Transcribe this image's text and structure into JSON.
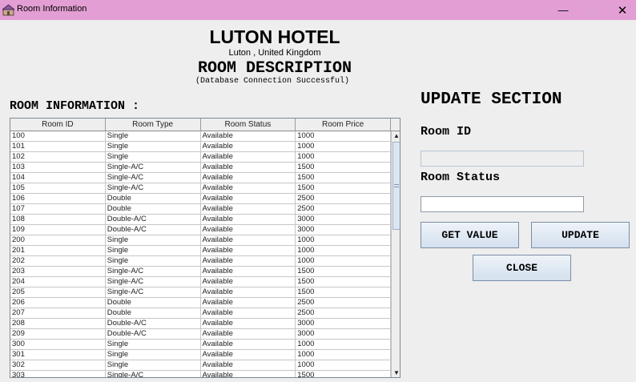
{
  "window": {
    "title": "Room Information",
    "min_glyph": "—",
    "max_glyph": "☐",
    "close_glyph": "✕"
  },
  "header": {
    "hotel_name": "LUTON HOTEL",
    "location": "Luton , United Kingdom",
    "section_title": "ROOM DESCRIPTION",
    "db_status": "(Database Connection Successful)"
  },
  "room_info_label": "ROOM INFORMATION :",
  "table": {
    "columns": [
      "Room ID",
      "Room Type",
      "Room Status",
      "Room Price"
    ],
    "rows": [
      [
        "100",
        "Single",
        "Available",
        "1000"
      ],
      [
        "101",
        "Single",
        "Available",
        "1000"
      ],
      [
        "102",
        "Single",
        "Available",
        "1000"
      ],
      [
        "103",
        "Single-A/C",
        "Available",
        "1500"
      ],
      [
        "104",
        "Single-A/C",
        "Available",
        "1500"
      ],
      [
        "105",
        "Single-A/C",
        "Available",
        "1500"
      ],
      [
        "106",
        "Double",
        "Available",
        "2500"
      ],
      [
        "107",
        "Double",
        "Available",
        "2500"
      ],
      [
        "108",
        "Double-A/C",
        "Available",
        "3000"
      ],
      [
        "109",
        "Double-A/C",
        "Available",
        "3000"
      ],
      [
        "200",
        "Single",
        "Available",
        "1000"
      ],
      [
        "201",
        "Single",
        "Available",
        "1000"
      ],
      [
        "202",
        "Single",
        "Available",
        "1000"
      ],
      [
        "203",
        "Single-A/C",
        "Available",
        "1500"
      ],
      [
        "204",
        "Single-A/C",
        "Available",
        "1500"
      ],
      [
        "205",
        "Single-A/C",
        "Available",
        "1500"
      ],
      [
        "206",
        "Double",
        "Available",
        "2500"
      ],
      [
        "207",
        "Double",
        "Available",
        "2500"
      ],
      [
        "208",
        "Double-A/C",
        "Available",
        "3000"
      ],
      [
        "209",
        "Double-A/C",
        "Available",
        "3000"
      ],
      [
        "300",
        "Single",
        "Available",
        "1000"
      ],
      [
        "301",
        "Single",
        "Available",
        "1000"
      ],
      [
        "302",
        "Single",
        "Available",
        "1000"
      ],
      [
        "303",
        "Single-A/C",
        "Available",
        "1500"
      ]
    ]
  },
  "update": {
    "title": "UPDATE SECTION",
    "room_id_label": "Room ID",
    "room_id_value": "",
    "room_status_label": "Room Status",
    "room_status_value": "",
    "get_value_button": "GET VALUE",
    "update_button": "UPDATE",
    "close_button": "CLOSE"
  },
  "colors": {
    "titlebar": "#e39fd4",
    "background": "#eeeeee",
    "button": "#d3e0ee"
  }
}
